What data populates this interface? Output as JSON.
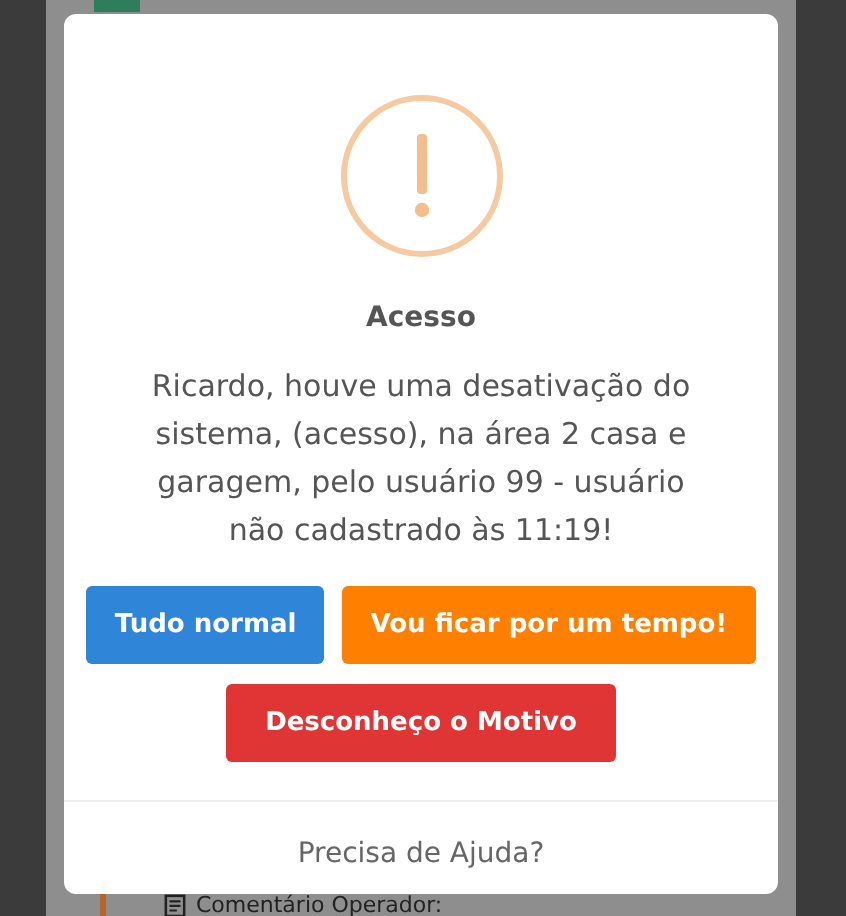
{
  "background": {
    "comment_label": "Comentário Operador:"
  },
  "dialog": {
    "title": "Acesso",
    "message": "Ricardo, houve uma desativação do sistema, (acesso), na área 2 casa e garagem, pelo usuário 99 - usuário não cadastrado às 11:19!",
    "buttons": [
      {
        "label": "Tudo normal",
        "kind": "primary"
      },
      {
        "label": "Vou ficar por um tempo!",
        "kind": "warning"
      },
      {
        "label": "Desconheço o Motivo",
        "kind": "danger"
      }
    ],
    "footer_link": "Precisa de Ajuda?"
  }
}
